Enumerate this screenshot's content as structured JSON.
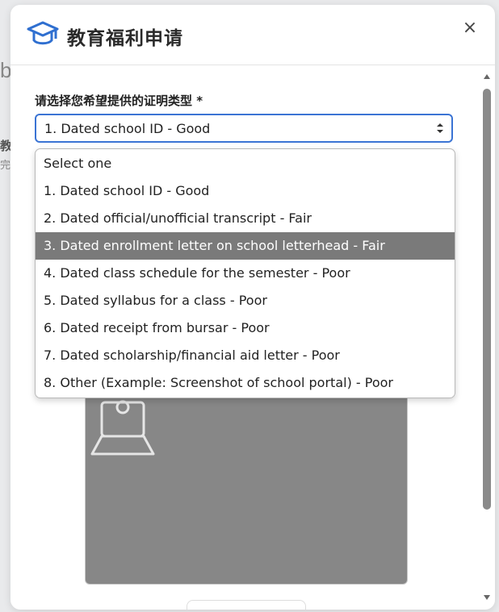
{
  "background": {
    "letter": "b",
    "side_text_1": "教",
    "side_text_2": "完"
  },
  "modal": {
    "title": "教育福利申请",
    "close_label": "×",
    "icon": "graduation-cap-icon"
  },
  "form": {
    "label": "请选择您希望提供的证明类型 *",
    "selected_value": "1. Dated school ID - Good",
    "options": [
      "Select one",
      "1. Dated school ID - Good",
      "2. Dated official/unofficial transcript - Fair",
      "3. Dated enrollment letter on school letterhead - Fair",
      "4. Dated class schedule for the semester - Poor",
      "5. Dated syllabus for a class - Poor",
      "6. Dated receipt from bursar - Poor",
      "7. Dated scholarship/financial aid letter - Poor",
      "8. Other (Example: Screenshot of school portal) - Poor"
    ],
    "highlighted_index": 3
  },
  "colors": {
    "accent": "#3b74d4",
    "highlight": "#7a7a7a"
  }
}
